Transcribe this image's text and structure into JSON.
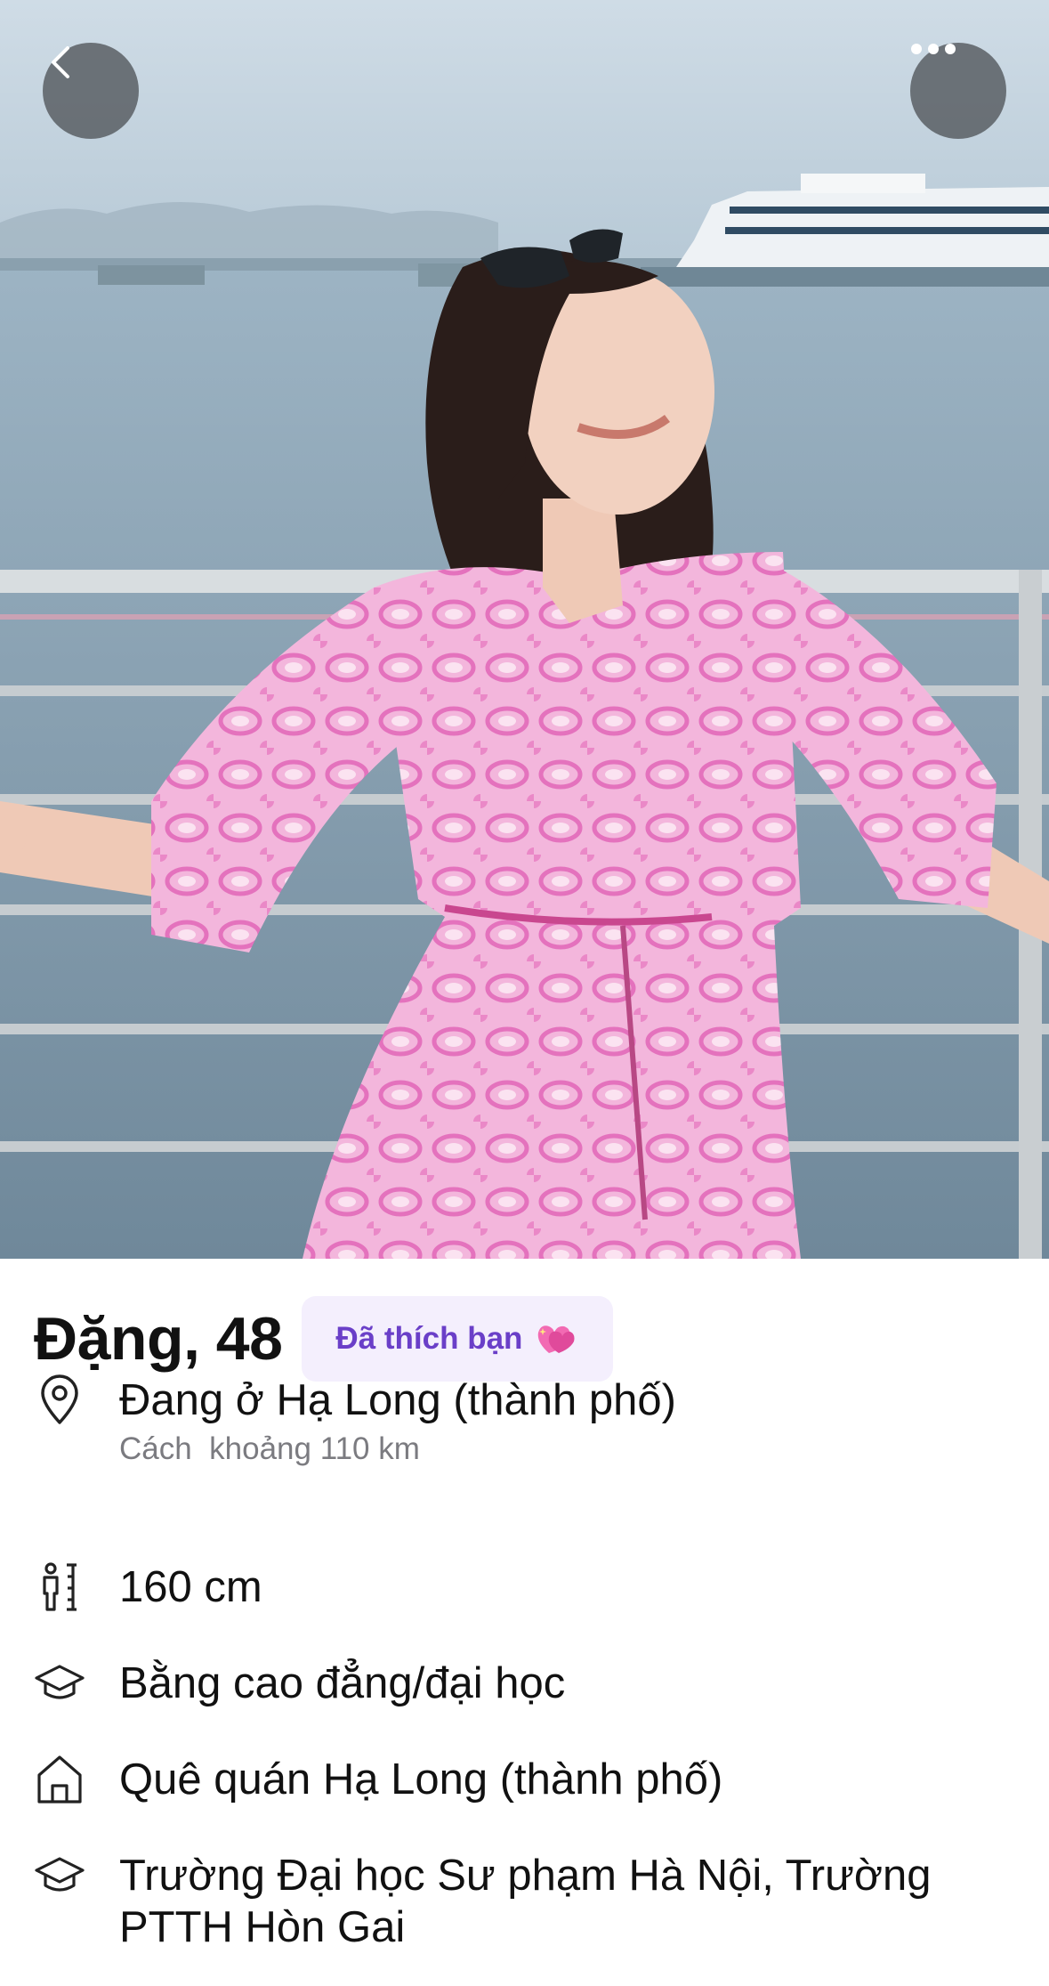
{
  "profile": {
    "name_age": "Đặng, 48",
    "liked_badge": "Đã thích bạn",
    "liked_badge_icon": "sparkling-heart-icon"
  },
  "details": {
    "location": {
      "icon": "location-pin-icon",
      "text": "Đang ở Hạ Long (thành phố)",
      "distance": "Cách  khoảng 110 km"
    },
    "height": {
      "icon": "height-icon",
      "text": "160 cm"
    },
    "education_level": {
      "icon": "graduation-cap-icon",
      "text": "Bằng cao đẳng/đại học"
    },
    "hometown": {
      "icon": "home-icon",
      "text": "Quê quán Hạ Long (thành phố)"
    },
    "schools": {
      "icon": "graduation-cap-icon",
      "text": "Trường Đại học Sư phạm Hà Nội, Trường PTTH Hòn Gai"
    }
  },
  "colors": {
    "accent": "#6a3fc8",
    "badge_bg": "#f4effd",
    "overlay_button": "#555a5f"
  }
}
